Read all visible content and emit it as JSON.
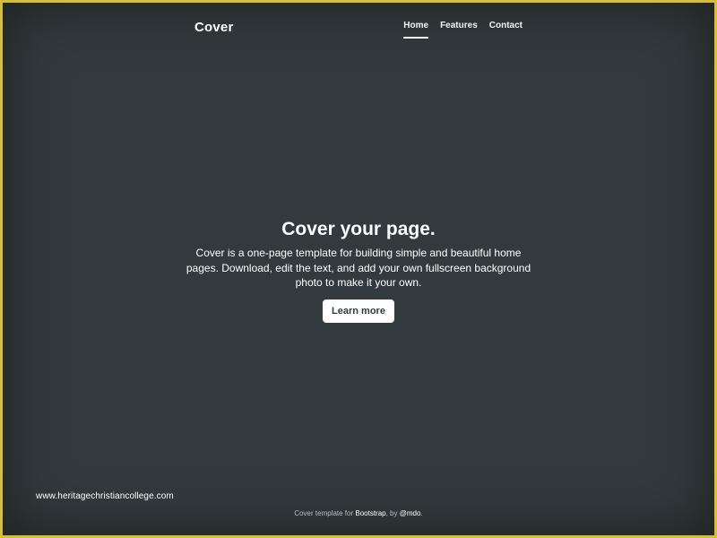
{
  "header": {
    "brand": "Cover",
    "nav": [
      {
        "label": "Home",
        "active": true
      },
      {
        "label": "Features",
        "active": false
      },
      {
        "label": "Contact",
        "active": false
      }
    ]
  },
  "hero": {
    "title": "Cover your page.",
    "lead": "Cover is a one-page template for building simple and beautiful home pages. Download, edit the text, and add your own fullscreen background photo to make it your own.",
    "button_label": "Learn more"
  },
  "watermark": "www.heritagechristiancollege.com",
  "footer": {
    "prefix": "Cover template for ",
    "link1": "Bootstrap",
    "middle": ", by ",
    "link2": "@mdo",
    "suffix": "."
  },
  "colors": {
    "page_border": "#d7c130",
    "background": "#333a3d",
    "text": "#ffffff",
    "footer_text": "#b8bec1"
  }
}
